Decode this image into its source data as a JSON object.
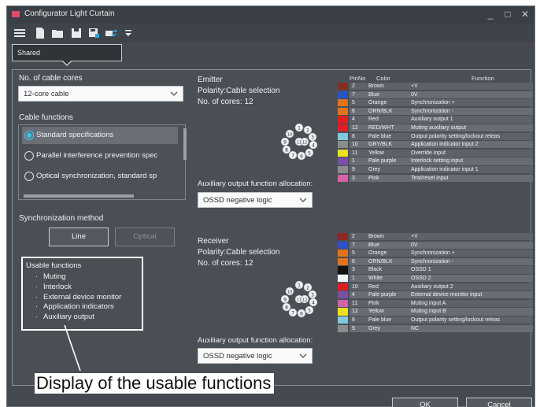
{
  "window": {
    "title": "Configurator Light Curtain",
    "minimize": "_",
    "maximize": "□",
    "close": "✕"
  },
  "toolbar": {
    "icons": [
      "menu-icon",
      "new-file-icon",
      "open-folder-icon",
      "save-icon",
      "save-as-icon",
      "transfer-icon",
      "dropdown-icon"
    ]
  },
  "profile": {
    "label": "Shared"
  },
  "cable": {
    "cores_label": "No. of cable cores",
    "cores_value": "12-core cable"
  },
  "cable_functions": {
    "label": "Cable functions",
    "items": [
      {
        "label": "Standard specifications",
        "selected": true
      },
      {
        "label": "Parallel interference prevention spec",
        "selected": false
      },
      {
        "label": "Optical synchronization, standard sp",
        "selected": false
      }
    ]
  },
  "sync": {
    "label": "Synchronization method",
    "line_button": "Line",
    "optical_button": "Optical"
  },
  "usable_functions": {
    "title": "Usable functions",
    "items": [
      "Muting",
      "Interlock",
      "External device monitor",
      "Application indicators",
      "Auxiliary output"
    ]
  },
  "emitter": {
    "title": "Emitter",
    "polarity": "Polarity:Cable selection",
    "cores": "No. of cores: 12",
    "aux_label": "Auxiliary output function allocation:",
    "aux_value": "OSSD negative logic"
  },
  "receiver": {
    "title": "Receiver",
    "polarity": "Polarity:Cable selection",
    "cores": "No. of cores: 12",
    "aux_label": "Auxiliary output function allocation:",
    "aux_value": "OSSD negative logic"
  },
  "pin_table": {
    "header_pin": "PinNo",
    "header_color": "Color",
    "header_function": "Function"
  },
  "emitter_pins": [
    {
      "pin": "2",
      "color": "Brown",
      "function": "+V",
      "swatch": "#8b2a1f"
    },
    {
      "pin": "7",
      "color": "Blue",
      "function": "0V",
      "swatch": "#2a52c8"
    },
    {
      "pin": "5",
      "color": "Orange",
      "function": "Synchronization +",
      "swatch": "#e0741c"
    },
    {
      "pin": "6",
      "color": "ORN/BLK",
      "function": "Synchronization -",
      "swatch": "#e0741c"
    },
    {
      "pin": "4",
      "color": "Red",
      "function": "Auxiliary output 1",
      "swatch": "#e01e1e"
    },
    {
      "pin": "12",
      "color": "RED/WHT",
      "function": "Muting auxiliary output",
      "swatch": "#e01e1e"
    },
    {
      "pin": "8",
      "color": "Pale blue",
      "function": "Output polarity setting/lockout releas",
      "swatch": "#7fc8e0"
    },
    {
      "pin": "10",
      "color": "GRY/BLK",
      "function": "Application indicator input 2",
      "swatch": "#8c8c8c"
    },
    {
      "pin": "11",
      "color": "Yellow",
      "function": "Override input",
      "swatch": "#f0e01e"
    },
    {
      "pin": "1",
      "color": "Pale purple",
      "function": "Interlock setting input",
      "swatch": "#7a4fa8"
    },
    {
      "pin": "9",
      "color": "Grey",
      "function": "Application indicator input 1",
      "swatch": "#8c8c8c"
    },
    {
      "pin": "3",
      "color": "Pink",
      "function": "Test/reset input",
      "swatch": "#d860a8"
    }
  ],
  "receiver_pins": [
    {
      "pin": "2",
      "color": "Brown",
      "function": "+V",
      "swatch": "#8b2a1f"
    },
    {
      "pin": "7",
      "color": "Blue",
      "function": "0V",
      "swatch": "#2a52c8"
    },
    {
      "pin": "5",
      "color": "Orange",
      "function": "Synchronization +",
      "swatch": "#e0741c"
    },
    {
      "pin": "6",
      "color": "ORN/BLK",
      "function": "Synchronization -",
      "swatch": "#e0741c"
    },
    {
      "pin": "3",
      "color": "Black",
      "function": "OSSD 1",
      "swatch": "#111111"
    },
    {
      "pin": "1",
      "color": "White",
      "function": "OSSD 2",
      "swatch": "#f4f4f4"
    },
    {
      "pin": "10",
      "color": "Red",
      "function": "Auxiliary output 2",
      "swatch": "#e01e1e"
    },
    {
      "pin": "4",
      "color": "Pale purple",
      "function": "External device monitor input",
      "swatch": "#7a4fa8"
    },
    {
      "pin": "11",
      "color": "Pink",
      "function": "Muting input A",
      "swatch": "#d860a8"
    },
    {
      "pin": "12",
      "color": "Yellow",
      "function": "Muting input B",
      "swatch": "#f0e01e"
    },
    {
      "pin": "8",
      "color": "Pale blue",
      "function": "Output polarity setting/lockout releas",
      "swatch": "#7fc8e0"
    },
    {
      "pin": "9",
      "color": "Grey",
      "function": "NC",
      "swatch": "#8c8c8c"
    }
  ],
  "connector": {
    "pins": [
      "1",
      "2",
      "3",
      "4",
      "5",
      "6",
      "7",
      "8",
      "9",
      "10",
      "11",
      "12"
    ]
  },
  "footer": {
    "ok": "OK",
    "cancel": "Cancel"
  },
  "caption": "Display of the usable functions",
  "colors": {
    "accent": "#39c6ea",
    "panel": "#4a4f55",
    "window": "#454a50"
  }
}
